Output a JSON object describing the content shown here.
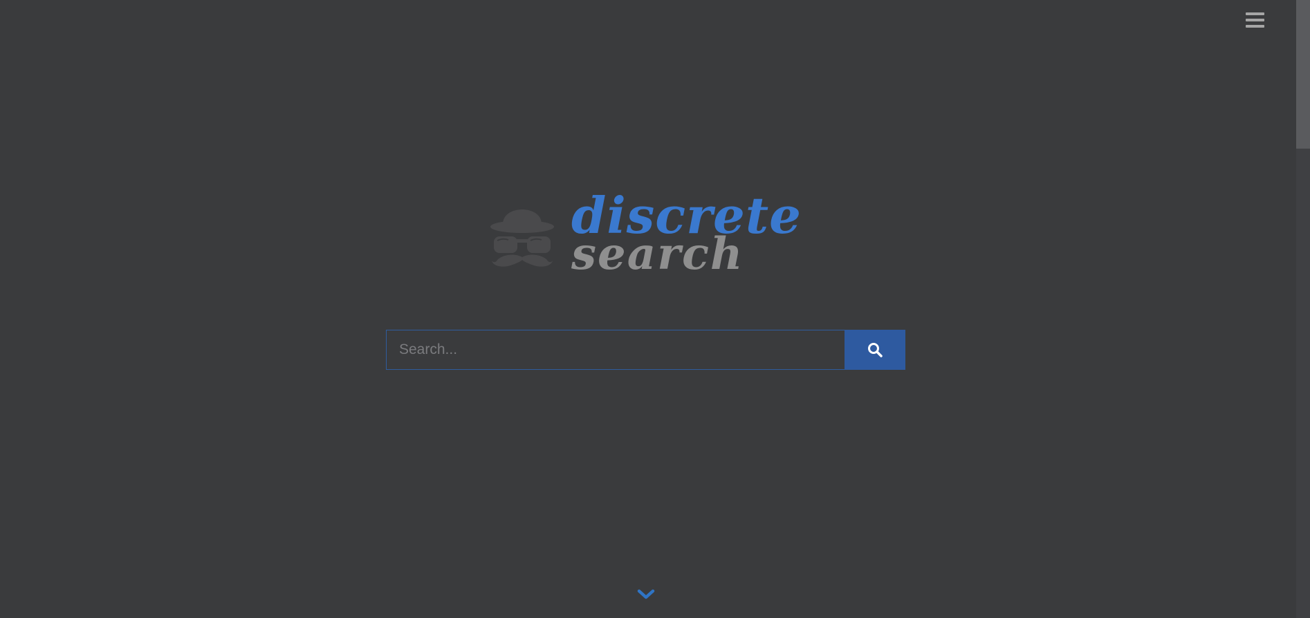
{
  "header": {
    "menu_icon": "hamburger-menu-icon"
  },
  "logo": {
    "word_primary": "discrete",
    "word_secondary": "search",
    "mascot_icon": "incognito-hat-glasses-mustache-icon"
  },
  "search": {
    "placeholder": "Search...",
    "value": "",
    "button_icon": "search-icon"
  },
  "footer": {
    "scroll_icon": "chevron-down-icon"
  },
  "colors": {
    "background": "#3a3b3d",
    "accent": "#3a79cf",
    "button": "#2e5aa0",
    "muted_text": "#8f8f8f"
  }
}
